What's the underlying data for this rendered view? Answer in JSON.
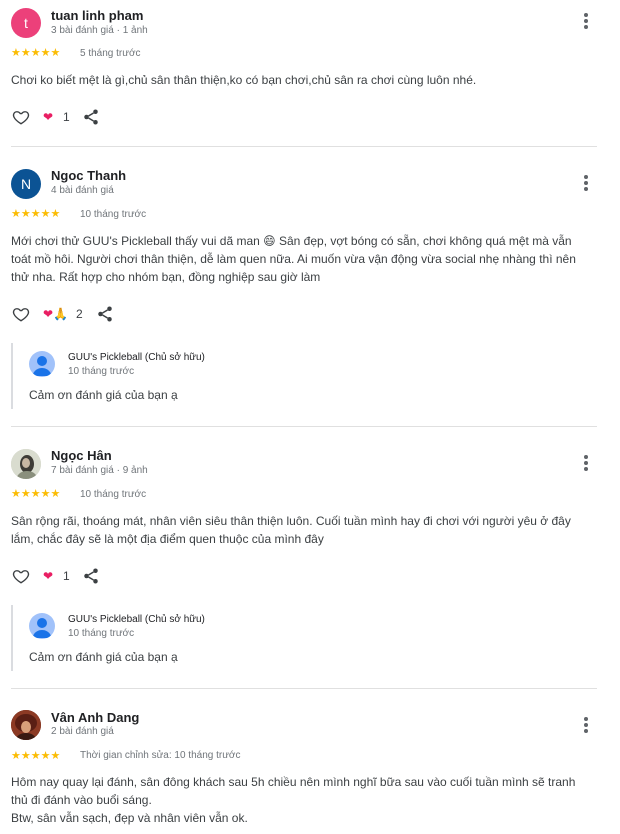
{
  "reviews": [
    {
      "initial": "t",
      "avatar_color": "#ec407a",
      "name": "tuan linh pham",
      "meta": "3 bài đánh giá · 1 ảnh",
      "stars": "★★★★★",
      "rating": 5,
      "date": "5 tháng trước",
      "text": "Chơi ko biết mệt là gì,chủ sân thân thiện,ko có bạn chơi,chủ sân ra chơi cùng luôn nhé.",
      "reactions": "❤",
      "reaction_count": "1"
    },
    {
      "initial": "N",
      "avatar_color": "#0b5394",
      "name": "Ngoc Thanh",
      "meta": "4 bài đánh giá",
      "stars": "★★★★★",
      "rating": 5,
      "date": "10 tháng trước",
      "text": "Mới chơi thử GUU's Pickleball thấy vui dã man 😄 Sân đẹp, vợt bóng có sẵn, chơi không quá mệt mà vẫn toát mồ hôi. Người chơi thân thiện, dễ làm quen nữa. Ai muốn vừa vận động vừa social nhẹ nhàng thì nên thử nha. Rất hợp cho nhóm bạn, đồng nghiệp sau giờ làm",
      "reactions": "❤🙏",
      "reaction_count": "2",
      "owner_reply": {
        "name": "GUU's Pickleball (Chủ sở hữu)",
        "date": "10 tháng trước",
        "text": "Cảm ơn đánh giá của bạn ạ"
      }
    },
    {
      "name": "Ngọc Hân",
      "meta": "7 bài đánh giá · 9 ảnh",
      "stars": "★★★★★",
      "rating": 5,
      "date": "10 tháng trước",
      "text": "Sân rộng rãi, thoáng mát, nhân viên siêu thân thiện luôn. Cuối tuần mình hay đi chơi với người yêu ở đây lắm, chắc đây sẽ là một địa điểm quen thuộc của mình đây",
      "reactions": "❤",
      "reaction_count": "1",
      "owner_reply": {
        "name": "GUU's Pickleball (Chủ sở hữu)",
        "date": "10 tháng trước",
        "text": "Cảm ơn đánh giá của bạn ạ"
      }
    },
    {
      "name": "Vân Anh Dang",
      "meta": "2 bài đánh giá",
      "stars": "★★★★★",
      "rating": 5,
      "date": "Thời gian chỉnh sửa: 10 tháng trước",
      "text": "Hôm nay quay lại đánh, sân đông khách sau 5h chiều nên mình nghĩ bữa sau vào cuối tuần mình sẽ tranh thủ đi đánh vào buổi sáng.",
      "text2": "Btw, sân vẫn sạch, đẹp và nhân viên vẫn ok."
    }
  ]
}
